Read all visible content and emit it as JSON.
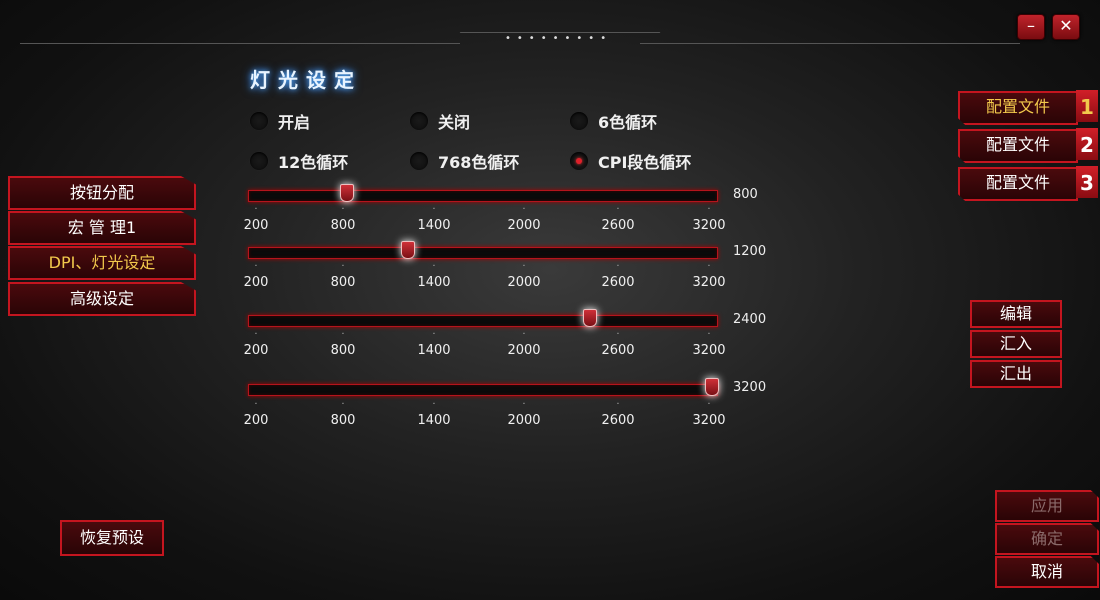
{
  "window": {
    "minimize_label": "–",
    "close_label": "✕",
    "title_dots": "•••••••••"
  },
  "section_title": "灯光设定",
  "light_modes": [
    {
      "label": "开启",
      "selected": false
    },
    {
      "label": "关闭",
      "selected": false
    },
    {
      "label": "6色循环",
      "selected": false
    },
    {
      "label": "12色循环",
      "selected": false
    },
    {
      "label": "768色循环",
      "selected": false
    },
    {
      "label": "CPI段色循环",
      "selected": true
    }
  ],
  "dpi_scale": {
    "min": 200,
    "max": 3200,
    "ticks": [
      "200",
      "800",
      "1400",
      "2000",
      "2600",
      "3200"
    ]
  },
  "dpi_levels": [
    {
      "value": 800,
      "value_label": "800"
    },
    {
      "value": 1200,
      "value_label": "1200"
    },
    {
      "value": 2400,
      "value_label": "2400"
    },
    {
      "value": 3200,
      "value_label": "3200"
    }
  ],
  "nav": [
    {
      "label": "按钮分配",
      "active": false
    },
    {
      "label": "宏 管 理1",
      "active": false
    },
    {
      "label": "DPI、灯光设定",
      "active": true
    },
    {
      "label": "高级设定",
      "active": false
    }
  ],
  "restore_label": "恢复预设",
  "profiles": [
    {
      "label": "配置文件",
      "number": "1",
      "active": true
    },
    {
      "label": "配置文件",
      "number": "2",
      "active": false
    },
    {
      "label": "配置文件",
      "number": "3",
      "active": false
    }
  ],
  "profile_actions": {
    "edit": "编辑",
    "import": "汇入",
    "export": "汇出"
  },
  "bottom_actions": {
    "apply": "应用",
    "confirm": "确定",
    "cancel": "取消"
  },
  "colors": {
    "accent_red": "#c4151f",
    "active_text": "#f2c94c",
    "title_glow": "#5ab3ff"
  }
}
